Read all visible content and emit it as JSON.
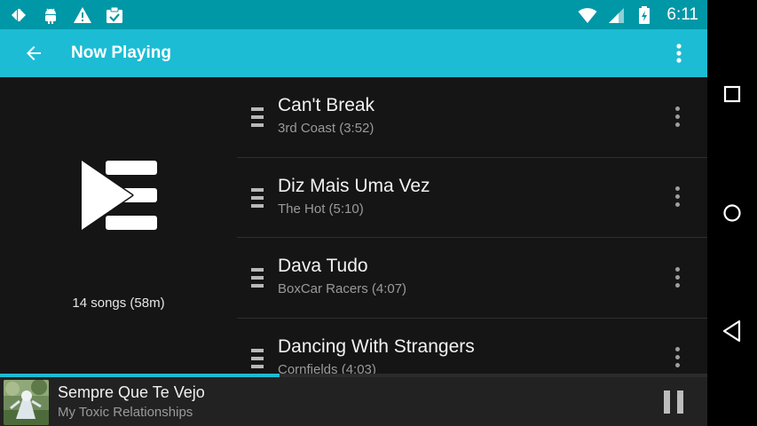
{
  "status_bar": {
    "time": "6:11",
    "left_icons": [
      "usb-debug-icon",
      "android-icon",
      "warning-icon",
      "task-done-icon"
    ],
    "right_icons": [
      "wifi-icon",
      "cell-signal-icon",
      "battery-charging-icon"
    ]
  },
  "app_bar": {
    "title": "Now Playing",
    "back_icon": "arrow-back-icon",
    "menu_icon": "overflow-menu-icon",
    "color": "#1cbcd4"
  },
  "album": {
    "song_count": "14 songs (58m)"
  },
  "songs": [
    {
      "title": "Can't Break",
      "subtitle": "3rd Coast (3:52)"
    },
    {
      "title": "Diz Mais Uma Vez",
      "subtitle": "The Hot (5:10)"
    },
    {
      "title": "Dava Tudo",
      "subtitle": "BoxCar Racers (4:07)"
    },
    {
      "title": "Dancing With Strangers",
      "subtitle": "Cornfields (4:03)"
    }
  ],
  "mini_player": {
    "title": "Sempre Que Te Vejo",
    "subtitle": "My Toxic Relationships",
    "progress_fraction": 0.395,
    "state_icon": "pause-icon"
  },
  "nav_bar": {
    "buttons": [
      "recents-icon",
      "home-icon",
      "back-icon"
    ]
  },
  "colors": {
    "status_bar": "#0097a7",
    "accent": "#1cbcd4",
    "background": "#151515"
  }
}
